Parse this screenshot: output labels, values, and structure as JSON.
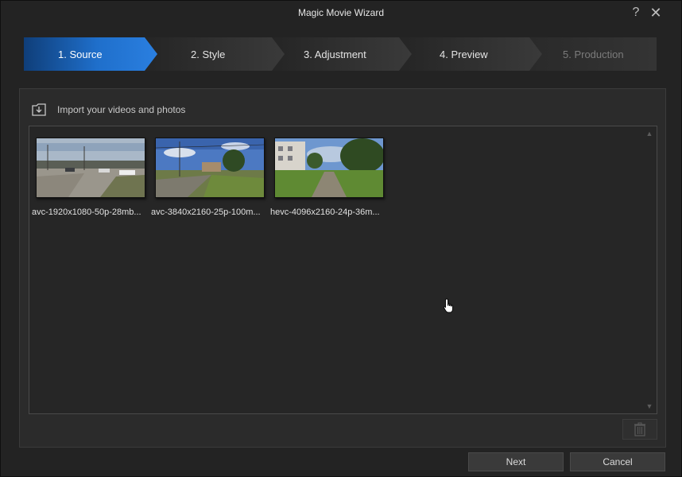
{
  "window": {
    "title": "Magic Movie Wizard",
    "help_glyph": "?",
    "close_glyph": "✕"
  },
  "steps": [
    {
      "label": "1. Source",
      "state": "active"
    },
    {
      "label": "2. Style",
      "state": "normal"
    },
    {
      "label": "3. Adjustment",
      "state": "normal"
    },
    {
      "label": "4. Preview",
      "state": "normal"
    },
    {
      "label": "5. Production",
      "state": "disabled"
    }
  ],
  "import": {
    "label": "Import your videos and photos",
    "icon": "import-icon"
  },
  "media": [
    {
      "name": "avc-1920x1080-50p-28mb..."
    },
    {
      "name": "avc-3840x2160-25p-100m..."
    },
    {
      "name": "hevc-4096x2160-24p-36m..."
    }
  ],
  "buttons": {
    "next": "Next",
    "cancel": "Cancel",
    "delete_icon": "trash-icon"
  },
  "colors": {
    "active_step": "#1e6fc6",
    "step_bg": "#303030",
    "background": "#232323"
  }
}
